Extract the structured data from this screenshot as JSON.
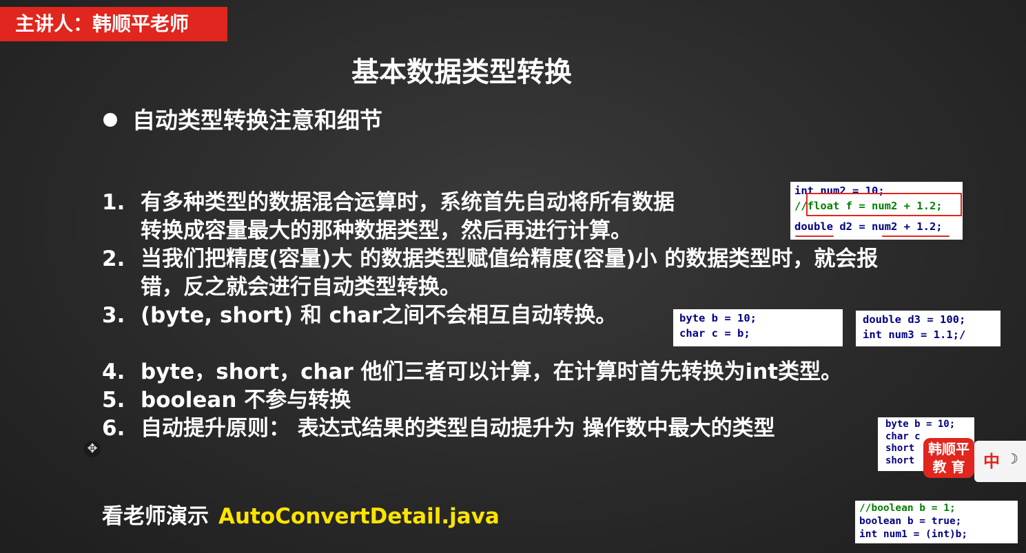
{
  "badge": "主讲人：韩顺平老师",
  "title": "基本数据类型转换",
  "subtitle": "自动类型转换注意和细节",
  "items": [
    {
      "num": "1.",
      "line1": "有多种类型的数据混合运算时，系统首先自动将所有数据",
      "line2": "转换成容量最大的那种数据类型，然后再进行计算。"
    },
    {
      "num": "2.",
      "line1": "当我们把精度(容量)大 的数据类型赋值给精度(容量)小 的数据类型时，就会报",
      "line2": "错，反之就会进行自动类型转换。"
    },
    {
      "num": "3.",
      "line1": "(byte, short) 和 char之间不会相互自动转换。"
    },
    {
      "num": "4.",
      "line1": "byte，short，char  他们三者可以计算，在计算时首先转换为int类型。"
    },
    {
      "num": "5.",
      "line1": "boolean 不参与转换"
    },
    {
      "num": "6.",
      "line1": "自动提升原则：  表达式结果的类型自动提升为 操作数中最大的类型"
    }
  ],
  "demo": {
    "label": "看老师演示",
    "file": "AutoConvertDetail.java"
  },
  "snippets": {
    "s1": [
      "int num2 = 10;",
      "//float f = num2 + 1.2;",
      "double d2 = num2 + 1.2;"
    ],
    "s2": [
      "byte b = 10;",
      "char c = b;"
    ],
    "s3": [
      "double d3 = 100;",
      "int num3 = 1.1;/"
    ],
    "s4": [
      "byte b = 10;",
      "char c",
      "short",
      "short"
    ],
    "s5": [
      "//boolean b = 1;",
      "boolean b = true;",
      "int num1 = (int)b;"
    ]
  },
  "logo": {
    "line1": "韩顺平",
    "line2": "教 育"
  },
  "ime": {
    "lang": "中",
    "mode": "☽"
  },
  "colors": {
    "badge": "#e0261e",
    "demo_file": "#ffe400",
    "background": "#2d2d2d"
  }
}
